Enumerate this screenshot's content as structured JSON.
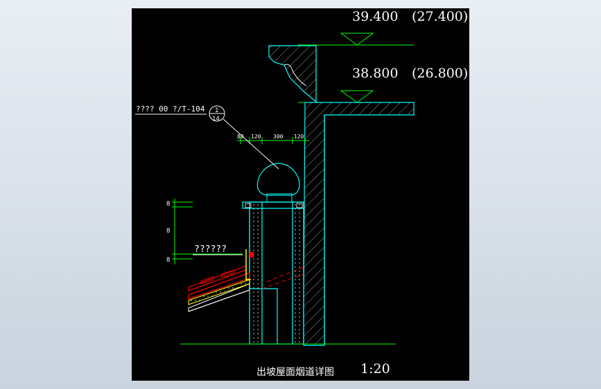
{
  "drawing": {
    "elevation_top": "39.400",
    "elevation_top_alt": "(27.400)",
    "elevation_mid": "38.800",
    "elevation_mid_alt": "(26.800)",
    "detail_ref_text": "???? 00  ?/T-104",
    "detail_num_top": "1",
    "detail_num_bottom": "14",
    "dims_top": [
      "80",
      "120",
      "300",
      "120"
    ],
    "dims_left": [
      "8",
      "8",
      "8"
    ],
    "flashing_label": "??????",
    "title": "出坡屋面烟道详图",
    "scale": "1:20"
  },
  "colors": {
    "background": "#000000",
    "wall_lines": "#00ffff",
    "dimension": "#00ff00",
    "roof_tile": "#ff0000",
    "insulation": "#ffff00",
    "text": "#ffffff"
  }
}
